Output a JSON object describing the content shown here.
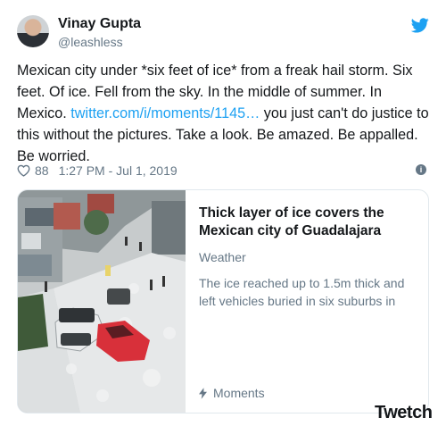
{
  "author": {
    "name": "Vinay Gupta",
    "handle": "@leashless",
    "avatar_icon": "avatar-photo"
  },
  "tweet": {
    "text_before_link": "Mexican city under *six feet of ice* from a freak hail storm. Six feet. Of ice. Fell from the sky. In the middle of summer. In Mexico. ",
    "link": "twitter.com/i/moments/1145…",
    "text_after_link": " you just can't do justice to this without the pictures. Take a look. Be amazed. Be appalled. Be worried."
  },
  "meta": {
    "like_count": "88",
    "timestamp": "1:27 PM - Jul 1, 2019",
    "heart_icon": "heart-outline-icon",
    "info_icon": "info-icon"
  },
  "card": {
    "title": "Thick layer of ice covers the Mexican city of Guadalajara",
    "category": "Weather",
    "description": "The ice reached up to 1.5m thick and left vehicles buried in six suburbs in",
    "footer_label": "Moments",
    "footer_icon": "lightning-bolt-icon"
  },
  "watermark": "Twetch",
  "colors": {
    "link": "#1da1f2",
    "secondary_text": "#657786",
    "primary_text": "#14171a",
    "border": "#e1e8ed"
  }
}
